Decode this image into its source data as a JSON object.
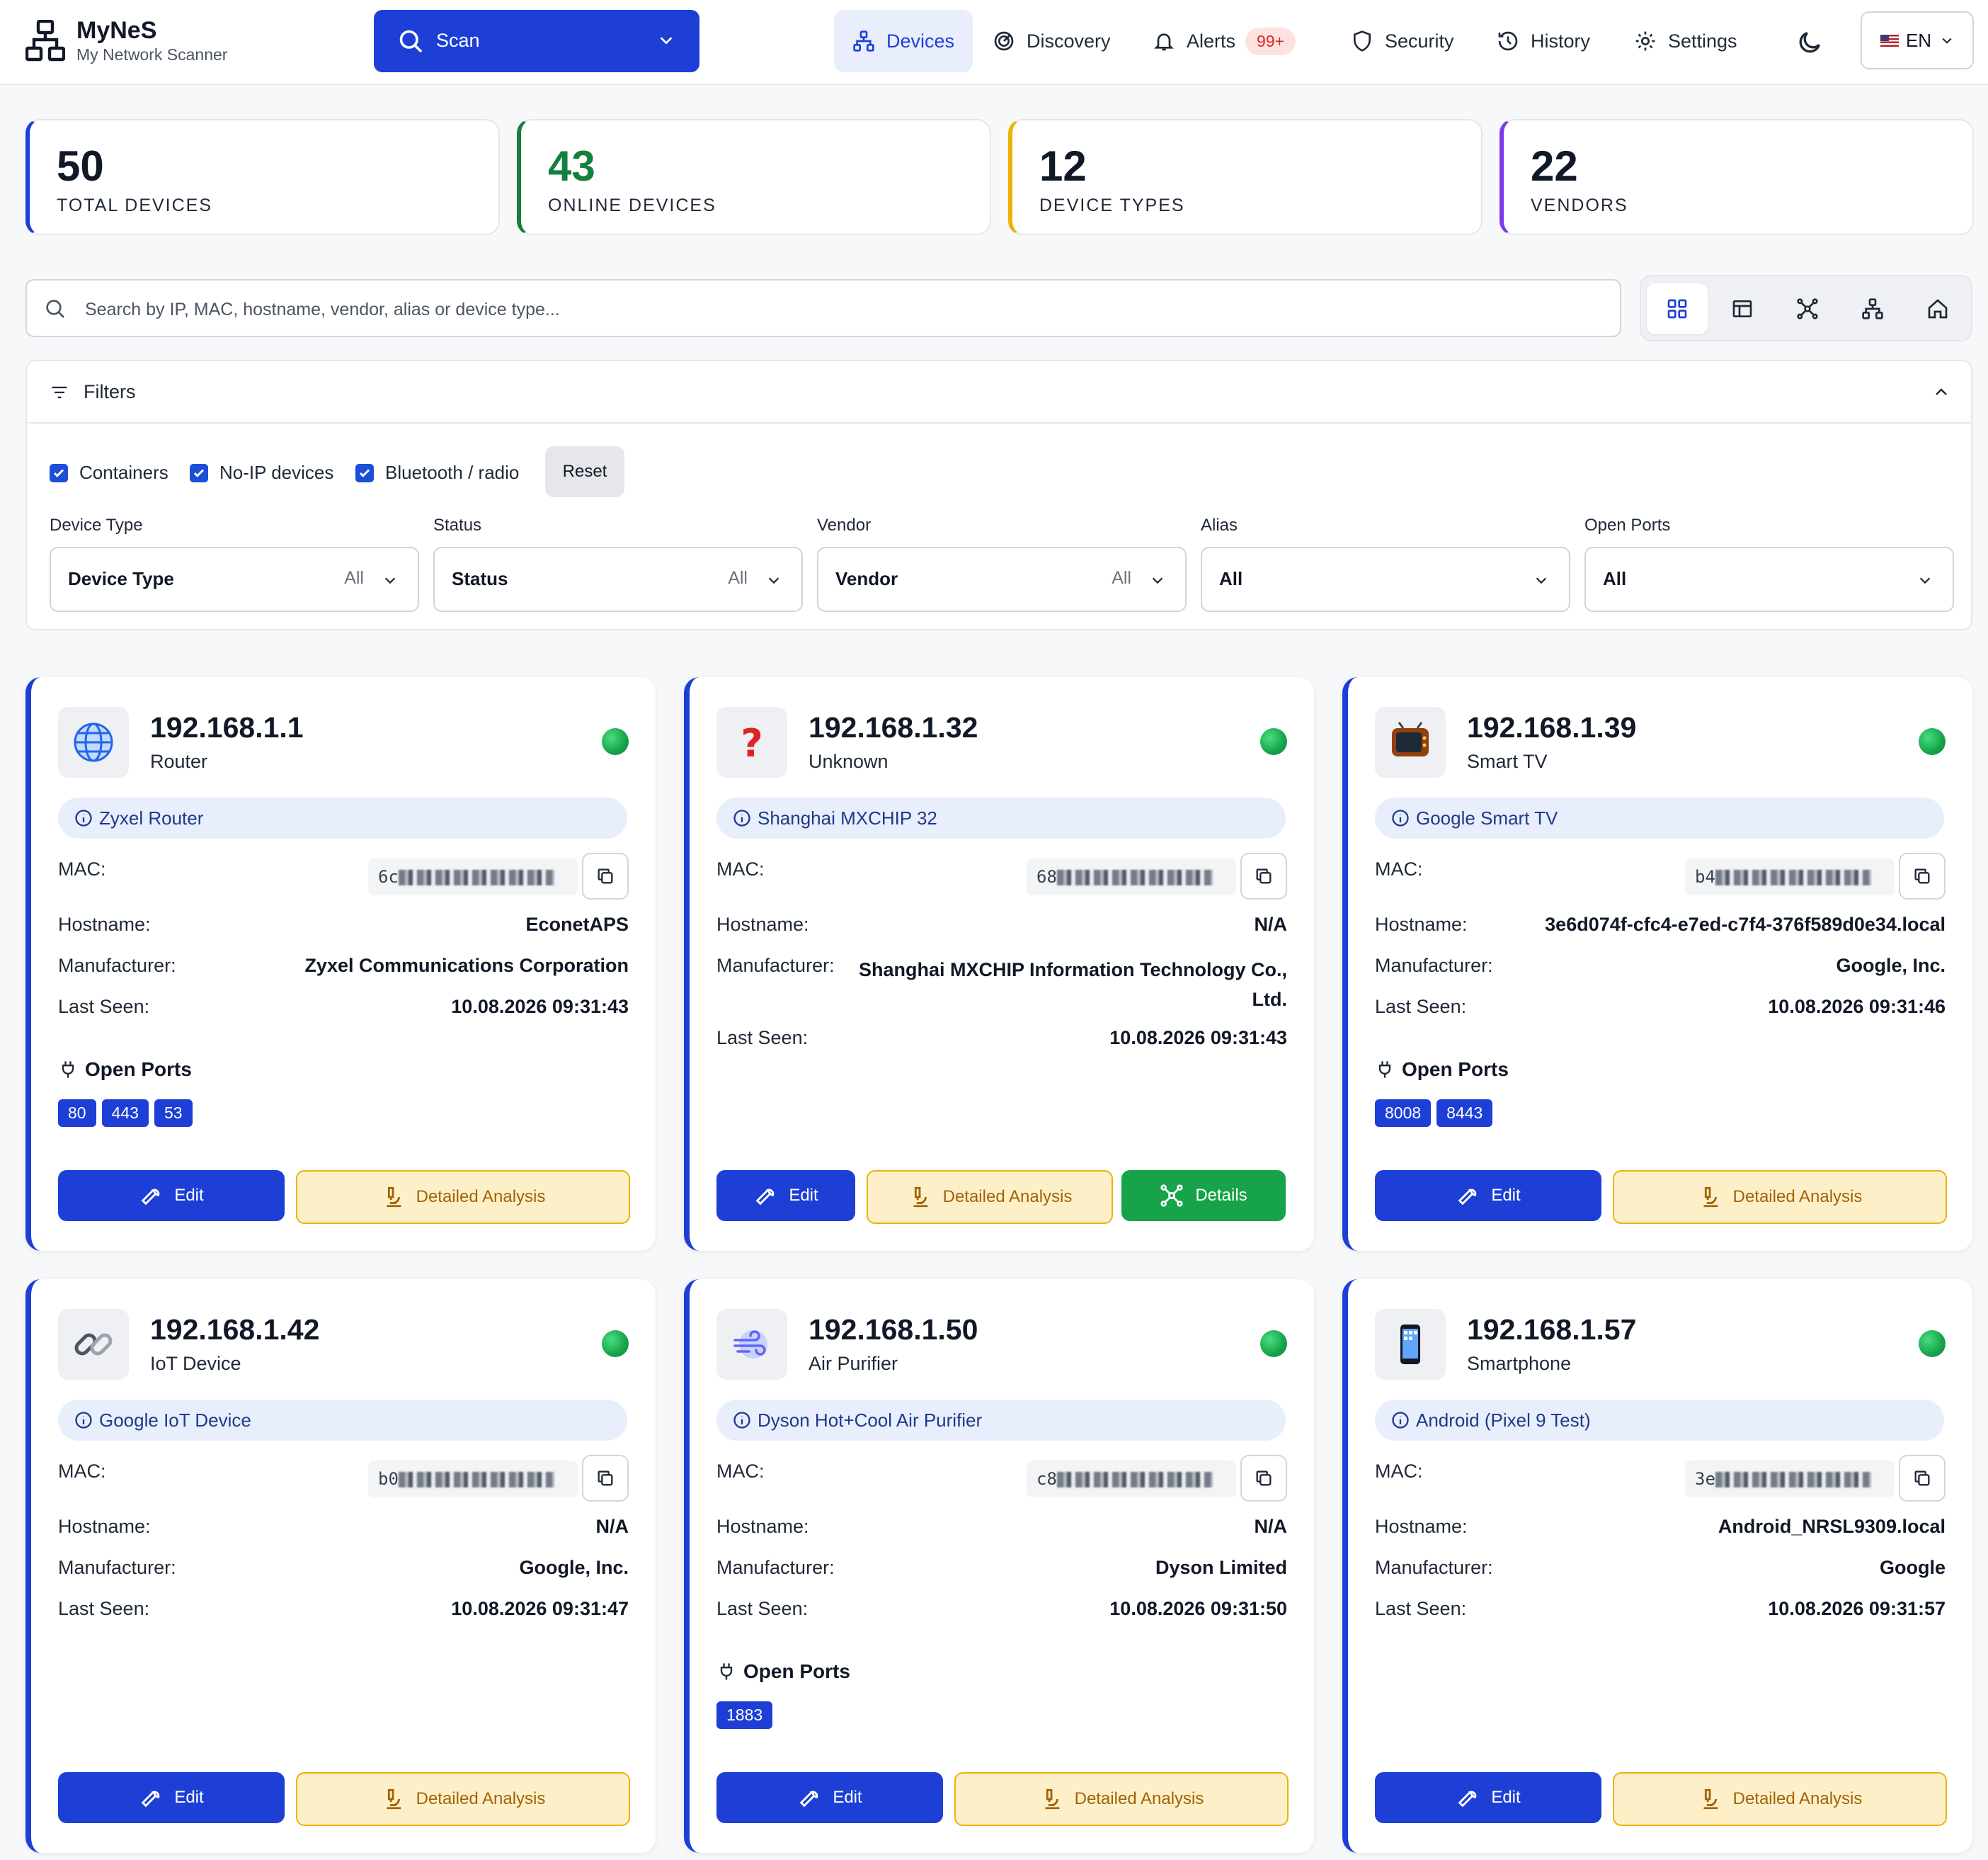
{
  "app": {
    "name": "MyNeS",
    "subtitle": "My Network Scanner"
  },
  "scan": {
    "label": "Scan"
  },
  "nav": {
    "devices": "Devices",
    "discovery": "Discovery",
    "alerts": "Alerts",
    "alerts_badge": "99+",
    "security": "Security",
    "history": "History",
    "settings": "Settings",
    "language": "EN"
  },
  "stats": [
    {
      "value": "50",
      "label": "TOTAL DEVICES",
      "color": "#1d3fd6"
    },
    {
      "value": "43",
      "label": "ONLINE DEVICES",
      "color": "#15803d"
    },
    {
      "value": "12",
      "label": "DEVICE TYPES",
      "color": "#eab308"
    },
    {
      "value": "22",
      "label": "VENDORS",
      "color": "#7c3aed"
    }
  ],
  "search": {
    "placeholder": "Search by IP, MAC, hostname, vendor, alias or device type..."
  },
  "filters": {
    "title": "Filters",
    "checkboxes": [
      "Containers",
      "No-IP devices",
      "Bluetooth / radio"
    ],
    "reset": "Reset",
    "selects": [
      {
        "label": "Device Type",
        "value": "Device Type",
        "aside": "All"
      },
      {
        "label": "Status",
        "value": "Status",
        "aside": "All"
      },
      {
        "label": "Vendor",
        "value": "Vendor",
        "aside": "All"
      },
      {
        "label": "Alias",
        "value": "All",
        "aside": ""
      },
      {
        "label": "Open Ports",
        "value": "All",
        "aside": ""
      }
    ]
  },
  "labels": {
    "mac": "MAC:",
    "hostname": "Hostname:",
    "manufacturer": "Manufacturer:",
    "last_seen": "Last Seen:",
    "open_ports": "Open Ports",
    "edit": "Edit",
    "analysis": "Detailed Analysis",
    "details": "Details"
  },
  "devices": [
    {
      "ip": "192.168.1.1",
      "type": "Router",
      "icon": "globe-icon",
      "alias": "Zyxel Router",
      "mac_prefix": "6c",
      "hostname": "EconetAPS",
      "manufacturer": "Zyxel Communications Corporation",
      "last_seen": "10.08.2026 09:31:43",
      "ports": [
        "80",
        "443",
        "53"
      ]
    },
    {
      "ip": "192.168.1.32",
      "type": "Unknown",
      "icon": "question-mark-icon",
      "alias": "Shanghai MXCHIP 32",
      "mac_prefix": "68",
      "hostname": "N/A",
      "manufacturer": "Shanghai MXCHIP Information Technology Co., Ltd.",
      "last_seen": "10.08.2026 09:31:43",
      "ports": []
    },
    {
      "ip": "192.168.1.39",
      "type": "Smart TV",
      "icon": "tv-icon",
      "alias": "Google Smart TV",
      "mac_prefix": "b4",
      "hostname": "3e6d074f-cfc4-e7ed-c7f4-376f589d0e34.local",
      "manufacturer": "Google, Inc.",
      "last_seen": "10.08.2026 09:31:46",
      "ports": [
        "8008",
        "8443"
      ]
    },
    {
      "ip": "192.168.1.42",
      "type": "IoT Device",
      "icon": "link-icon",
      "alias": "Google IoT Device",
      "mac_prefix": "b0",
      "hostname": "N/A",
      "manufacturer": "Google, Inc.",
      "last_seen": "10.08.2026 09:31:47",
      "ports": []
    },
    {
      "ip": "192.168.1.50",
      "type": "Air Purifier",
      "icon": "wind-icon",
      "alias": "Dyson Hot+Cool Air Purifier",
      "mac_prefix": "c8",
      "hostname": "N/A",
      "manufacturer": "Dyson Limited",
      "last_seen": "10.08.2026 09:31:50",
      "ports": [
        "1883"
      ]
    },
    {
      "ip": "192.168.1.57",
      "type": "Smartphone",
      "icon": "smartphone-icon",
      "alias": "Android (Pixel 9 Test)",
      "mac_prefix": "3e",
      "hostname": "Android_NRSL9309.local",
      "manufacturer": "Google",
      "last_seen": "10.08.2026 09:31:57",
      "ports": []
    }
  ]
}
